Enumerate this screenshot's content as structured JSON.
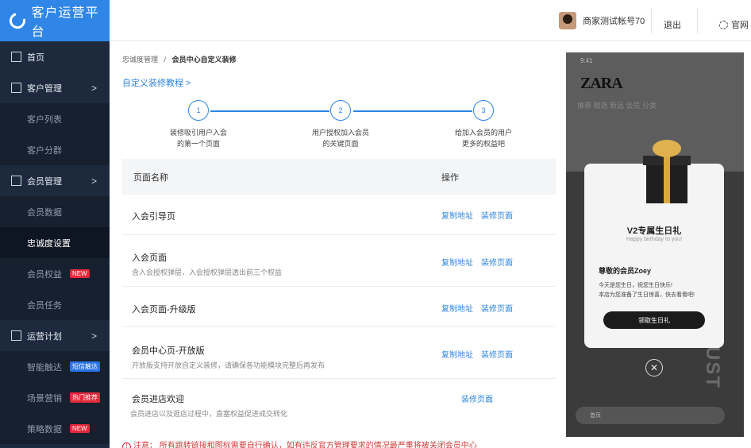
{
  "app": {
    "title": "客户运营平台"
  },
  "sidebar": {
    "items": [
      {
        "label": "首页",
        "level": "top",
        "icon": "home-icon"
      },
      {
        "label": "客户管理",
        "level": "top",
        "icon": "users-icon",
        "chevron": ">"
      },
      {
        "label": "客户列表",
        "level": "sub"
      },
      {
        "label": "客户分群",
        "level": "sub"
      },
      {
        "label": "会员管理",
        "level": "top",
        "icon": "member-icon",
        "chevron": ">"
      },
      {
        "label": "会员数据",
        "level": "sub"
      },
      {
        "label": "忠诚度设置",
        "level": "sub",
        "active": true
      },
      {
        "label": "会员权益",
        "level": "sub",
        "badge": "NEW",
        "badge_color": "red"
      },
      {
        "label": "会员任务",
        "level": "sub"
      },
      {
        "label": "运营计划",
        "level": "top",
        "icon": "plan-icon",
        "chevron": ">"
      },
      {
        "label": "智能触达",
        "level": "sub",
        "badge": "短信触达",
        "badge_color": "blue"
      },
      {
        "label": "场景营销",
        "level": "sub",
        "badge": "热门推荐",
        "badge_color": "red"
      },
      {
        "label": "策略数据",
        "level": "sub",
        "badge": "NEW",
        "badge_color": "red"
      }
    ]
  },
  "header": {
    "account": "商家测试帐号70",
    "logout": "退出",
    "official": "官网"
  },
  "breadcrumb": {
    "parent": "忠诚度管理",
    "sep": "/",
    "current": "会员中心自定义装修"
  },
  "tutorial": "自定义装修教程 >",
  "steps": [
    {
      "num": "1",
      "text": "装修吸引用户入会\n的第一个页面"
    },
    {
      "num": "2",
      "text": "用户授权加入会员\n的关键页面"
    },
    {
      "num": "3",
      "text": "给加入会员的用户\n更多的权益吧"
    }
  ],
  "table": {
    "col_name": "页面名称",
    "col_action": "操作",
    "rows": [
      {
        "name": "入会引导页",
        "desc": "",
        "copy": "复制地址",
        "decorate": "装修页面"
      },
      {
        "name": "入会页面",
        "desc": "含入会授权弹层，入会授权弹层透出前三个权益",
        "copy": "复制地址",
        "decorate": "装修页面"
      },
      {
        "name": "入会页面-升级版",
        "desc": "",
        "copy": "复制地址",
        "decorate": "装修页面"
      },
      {
        "name": "会员中心页-开放版",
        "desc": "开放版支持开放自定义装修，请确保各功能模块完整后再发布",
        "copy": "复制地址",
        "decorate": "装修页面"
      },
      {
        "name": "会员进店欢迎",
        "desc": "会员进店以及逛店过程中，直塞权益促进成交转化",
        "copy": "",
        "decorate": "装修页面"
      }
    ]
  },
  "notice": {
    "label": "注意：",
    "text": "所有跳转链接和图标需要自行确认，如有违反官方管理要求的情况最严重将被关闭会员中心"
  },
  "preview": {
    "status": "9:41",
    "brand": "ZARA",
    "tabs": "推荐   精选   新品   会员   分类",
    "modal_title": "V2专属生日礼",
    "modal_sub": "Happy birthday to you!",
    "dear": "尊敬的会员Zoey",
    "line1": "今天是您生日，祝您生日快乐!",
    "line2": "本店为您准备了生日惊喜，快去看看吧!",
    "button": "领取生日礼",
    "bottom": "首页"
  },
  "colors": {
    "brand": "#2f86e6",
    "sidebar": "#1d2a3e",
    "badge_red": "#e02a3a"
  }
}
